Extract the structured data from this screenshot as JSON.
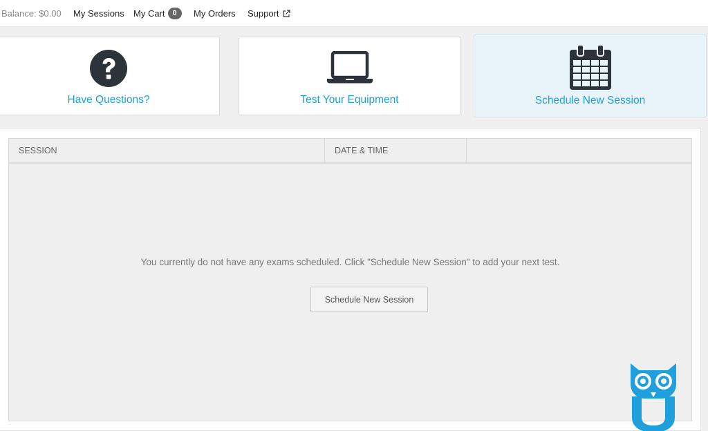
{
  "nav": {
    "balance": "Balance: $0.00",
    "my_sessions": "My Sessions",
    "my_cart": "My Cart",
    "cart_count": "0",
    "my_orders": "My Orders",
    "support": "Support"
  },
  "cards": {
    "questions": {
      "label": "Have Questions?",
      "icon": "question-circle-icon"
    },
    "equipment": {
      "label": "Test Your Equipment",
      "icon": "laptop-icon"
    },
    "schedule": {
      "label": "Schedule New Session",
      "icon": "calendar-icon"
    }
  },
  "table": {
    "headers": [
      "SESSION",
      "DATE & TIME",
      ""
    ],
    "empty_message": "You currently do not have any exams scheduled. Click \"Schedule New Session\" to add your next test.",
    "empty_button": "Schedule New Session"
  },
  "colors": {
    "accent": "#1fa0d2",
    "icon_dark": "#2d333b",
    "owl_blue": "#1f9fdb",
    "active_card_bg": "#e8f4f9"
  }
}
